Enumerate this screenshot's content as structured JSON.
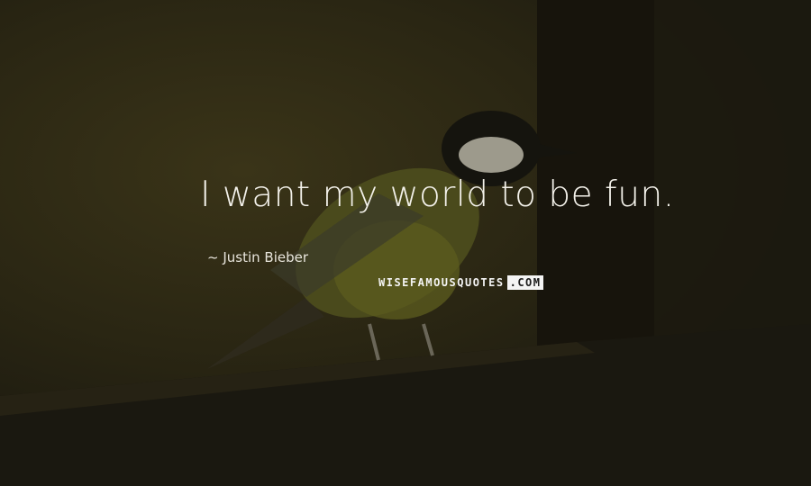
{
  "quote": {
    "text": "I want my world to be fun.",
    "author_prefix": "~",
    "author": "Justin Bieber"
  },
  "watermark": {
    "main": "WISEFAMOUSQUOTES",
    "tld": ".COM"
  },
  "colors": {
    "background": "#1f1c12",
    "text": "#f3f1ea"
  }
}
